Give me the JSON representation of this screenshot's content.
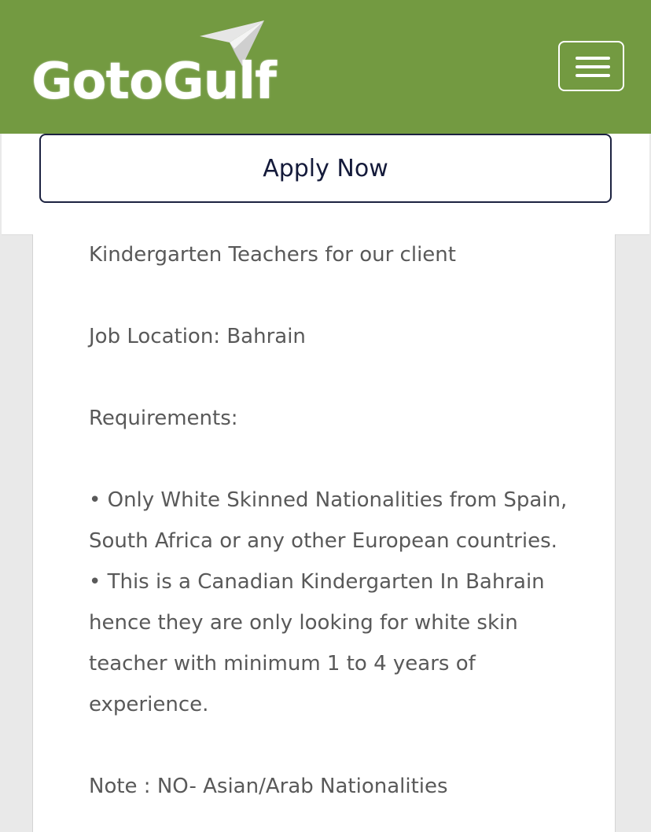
{
  "header": {
    "logo_text": "GotoGulf",
    "logo_icon": "paper-plane-icon",
    "menu_icon": "hamburger-menu-icon",
    "background_color": "#739a41"
  },
  "apply": {
    "button_label": "Apply Now"
  },
  "content": {
    "intro": "Kindergarten Teachers for our client",
    "location": "Job Location: Bahrain",
    "requirements_heading": "Requirements:",
    "bullets": [
      "• Only White Skinned Nationalities from Spain, South Africa or any other European countries.",
      "• This is a Canadian Kindergarten In Bahrain hence they are only looking for white skin teacher with minimum 1 to 4 years of experience."
    ],
    "note": "Note : NO- Asian/Arab Nationalities"
  }
}
